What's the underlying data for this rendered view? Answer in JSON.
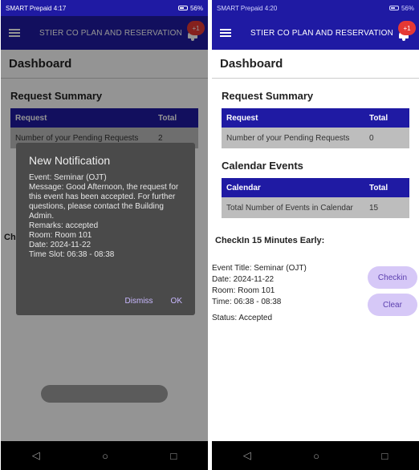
{
  "left": {
    "status": {
      "carrier": "SMART Prepaid",
      "time": "4:17",
      "battery": "56%"
    },
    "appbar": {
      "title": "STIER CO PLAN AND RESERVATION",
      "badge": "+1"
    },
    "dashboard": "Dashboard",
    "request_summary": {
      "title": "Request Summary",
      "headers": [
        "Request",
        "Total"
      ],
      "row": [
        "Number of your Pending Requests",
        "2"
      ]
    },
    "dialog": {
      "title": "New Notification",
      "lines": [
        "Event: Seminar (OJT)",
        "Message: Good Afternoon, the request for this event has been accepted. For further questions, please contact the Building Admin.",
        "Remarks: accepted",
        "Room: Room 101",
        "Date: 2024-11-22",
        "Time Slot: 06:38 - 08:38"
      ],
      "dismiss": "Dismiss",
      "ok": "OK"
    },
    "peek": {
      "c": "C",
      "ch": "Ch"
    }
  },
  "right": {
    "status": {
      "carrier": "SMART Prepaid",
      "time": "4:20",
      "battery": "56%"
    },
    "appbar": {
      "title": "STIER CO PLAN AND RESERVATION",
      "badge": "+1"
    },
    "dashboard": "Dashboard",
    "request_summary": {
      "title": "Request Summary",
      "headers": [
        "Request",
        "Total"
      ],
      "row": [
        "Number of your Pending Requests",
        "0"
      ]
    },
    "calendar": {
      "title": "Calendar Events",
      "headers": [
        "Calendar",
        "Total"
      ],
      "row": [
        "Total Number of Events in Calendar",
        "15"
      ]
    },
    "checkin": {
      "title": "CheckIn 15 Minutes Early:",
      "event_title": "Event Title: Seminar (OJT)",
      "date": "Date: 2024-11-22",
      "room": "Room: Room 101",
      "time": "Time: 06:38 - 08:38",
      "status": "Status:   Accepted",
      "checkin_button": "Checkin",
      "clear_button": "Clear"
    }
  },
  "nav": {
    "back": "◁",
    "home": "○",
    "recent": "□"
  },
  "colors": {
    "primary": "#1f1aa3",
    "row": "#bdbdbd",
    "pill": "#d6c8f7",
    "badge": "#e53935"
  }
}
